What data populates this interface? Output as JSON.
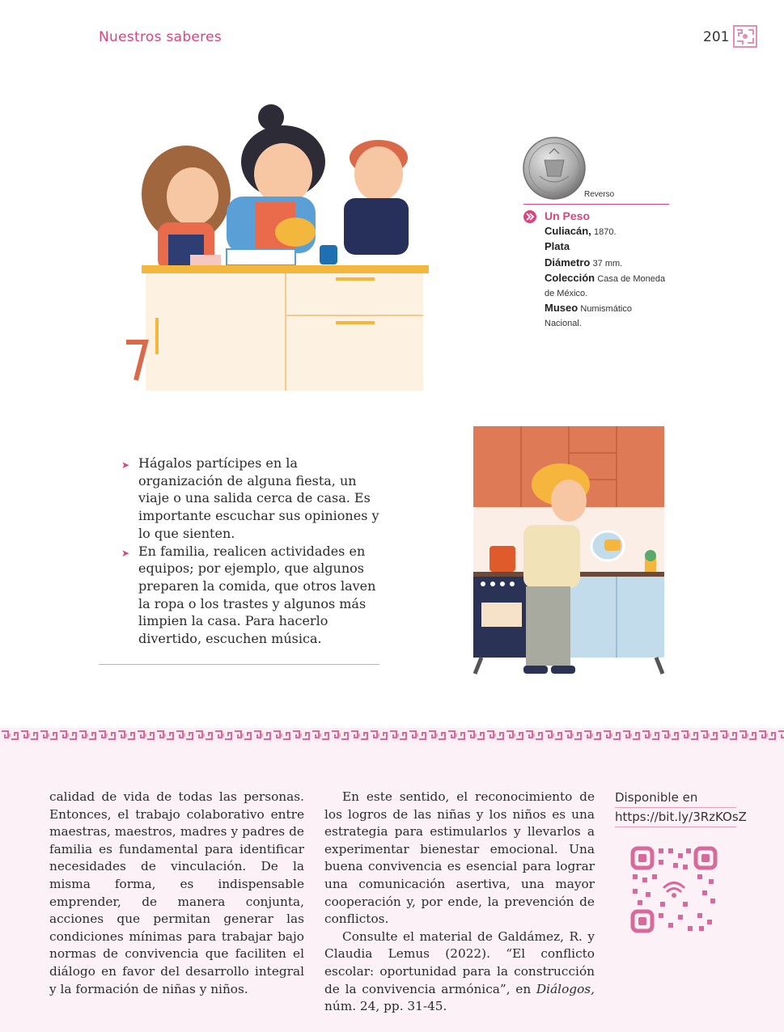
{
  "header": {
    "section_title": "Nuestros saberes",
    "page_number": "201"
  },
  "coin": {
    "caption": "Reverso",
    "title": "Un Peso",
    "lines": [
      {
        "label": "Culiacán,",
        "value": "1870."
      },
      {
        "label": "Plata",
        "value": ""
      },
      {
        "label": "Diámetro",
        "value": "37 mm."
      },
      {
        "label": "Colección",
        "value": "Casa de Moneda de México."
      },
      {
        "label": "Museo",
        "value": "Numismático Nacional."
      }
    ]
  },
  "bullets": [
    "Hágalos partícipes en la organización de alguna fiesta, un viaje o una salida cerca de casa. Es importante escuchar sus opiniones y lo que sienten.",
    "En familia, realicen actividades en equipos; por ejemplo, que algunos preparen la comida, que otros laven la ropa o los trastes y algunos más limpien la casa. Para hacerlo divertido, escuchen música."
  ],
  "footer": {
    "left_text": "calidad de vida de todas las personas. Entonces, el trabajo colaborativo entre maestras, maestros, madres y padres de familia es fundamental para identificar necesidades de vinculación. De la misma forma, es indispensable emprender, de manera conjunta, acciones que permitan generar las condiciones mínimas para trabajar bajo normas de convivencia que faciliten el diálogo en favor del desarrollo integral y la formación de niñas y niños.",
    "mid_p1": "En este sentido, el reconocimiento de los logros de las niñas y los niños es una estrategia para estimularlos y llevarlos a experimentar bienestar emocional. Una buena convivencia es esencial para lograr una comunicación asertiva, una mayor cooperación y, por ende, la prevención de conflictos.",
    "mid_p2_start": "Consulte el material de Galdámez, R. y Claudia Lemus (2022). “El conflicto escolar: oportunidad para la construcción de la convivencia armónica”, en ",
    "mid_p2_italic": "Diálogos,",
    "mid_p2_end": " núm. 24, pp. 31-45.",
    "link_label": "Disponible en",
    "link_url": "https://bit.ly/3RzKOsZ"
  },
  "colors": {
    "accent": "#d8457e",
    "footer_bg": "#fcf1f6"
  }
}
